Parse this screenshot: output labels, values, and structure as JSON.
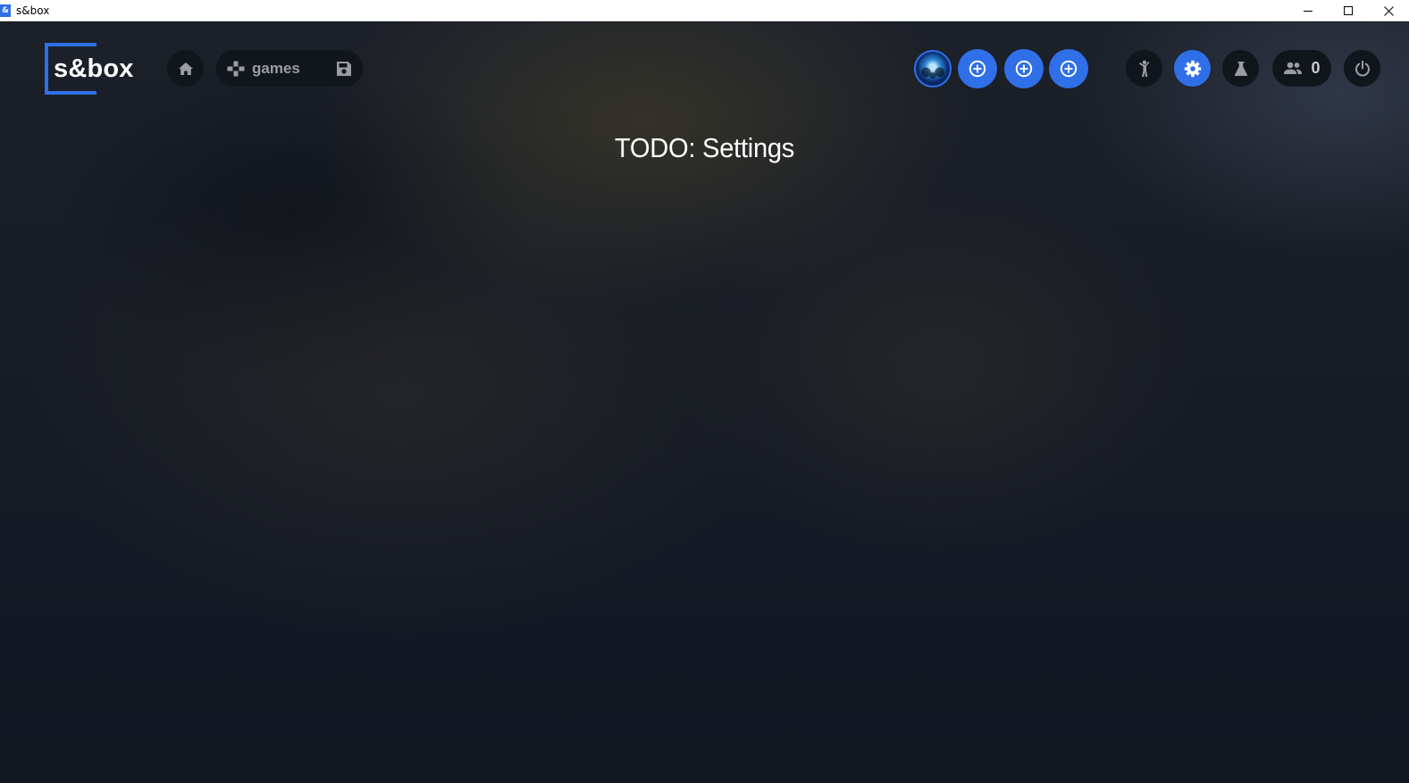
{
  "window": {
    "title": "s&box",
    "app_icon_glyph": "&",
    "controls": [
      "minimize-icon",
      "maximize-icon",
      "close-icon"
    ]
  },
  "header": {
    "logo_text": "s&box",
    "nav": {
      "home_icon": "home-icon",
      "games_label": "games",
      "games_icon": "gamepad-icon",
      "save_icon": "floppy-disk-icon"
    },
    "right": {
      "avatar_icon": "user-avatar",
      "add_slots": [
        "add-circle-icon",
        "add-circle-icon",
        "add-circle-icon"
      ],
      "player_icon": "person-icon",
      "settings_icon": "gear-icon",
      "lab_icon": "flask-icon",
      "friends_icon": "people-icon",
      "friends_count": "0",
      "power_icon": "power-icon"
    }
  },
  "main": {
    "heading": "TODO: Settings"
  },
  "colors": {
    "accent": "#2f6fe8",
    "pill_background": "#11151c",
    "text": "#ffffff"
  }
}
